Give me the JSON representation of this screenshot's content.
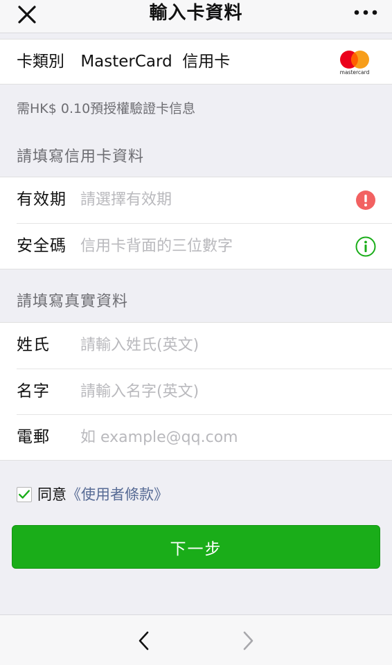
{
  "header": {
    "title": "輸入卡資料",
    "close_icon": "close-icon",
    "more_icon": "more-icon"
  },
  "card_type": {
    "label": "卡類別",
    "value": "MasterCard  信用卡",
    "logo": "mastercard",
    "logo_text": "mastercard"
  },
  "auth_note": "需HK$ 0.10預授權驗證卡信息",
  "card_section": {
    "title": "請填寫信用卡資料",
    "fields": [
      {
        "label": "有效期",
        "placeholder": "請選擇有效期",
        "value": "",
        "icon": "alert-icon"
      },
      {
        "label": "安全碼",
        "placeholder": "信用卡背面的三位數字",
        "value": "",
        "icon": "info-icon"
      }
    ]
  },
  "identity_section": {
    "title": "請填寫真實資料",
    "fields": [
      {
        "label": "姓氏",
        "placeholder": "請輸入姓氏(英文)",
        "value": ""
      },
      {
        "label": "名字",
        "placeholder": "請輸入名字(英文)",
        "value": ""
      },
      {
        "label": "電郵",
        "placeholder": "如 example@qq.com",
        "value": ""
      }
    ]
  },
  "agreement": {
    "checked": true,
    "text": "同意",
    "link": "《使用者條款》"
  },
  "next_button": "下一步",
  "bottom_nav": {
    "back_icon": "chevron-left-icon",
    "forward_icon": "chevron-right-icon"
  },
  "colors": {
    "primary_green": "#1aad19",
    "link_blue": "#576b95",
    "alert_red": "#f26161",
    "info_green": "#1aad19",
    "background": "#efeff4"
  }
}
